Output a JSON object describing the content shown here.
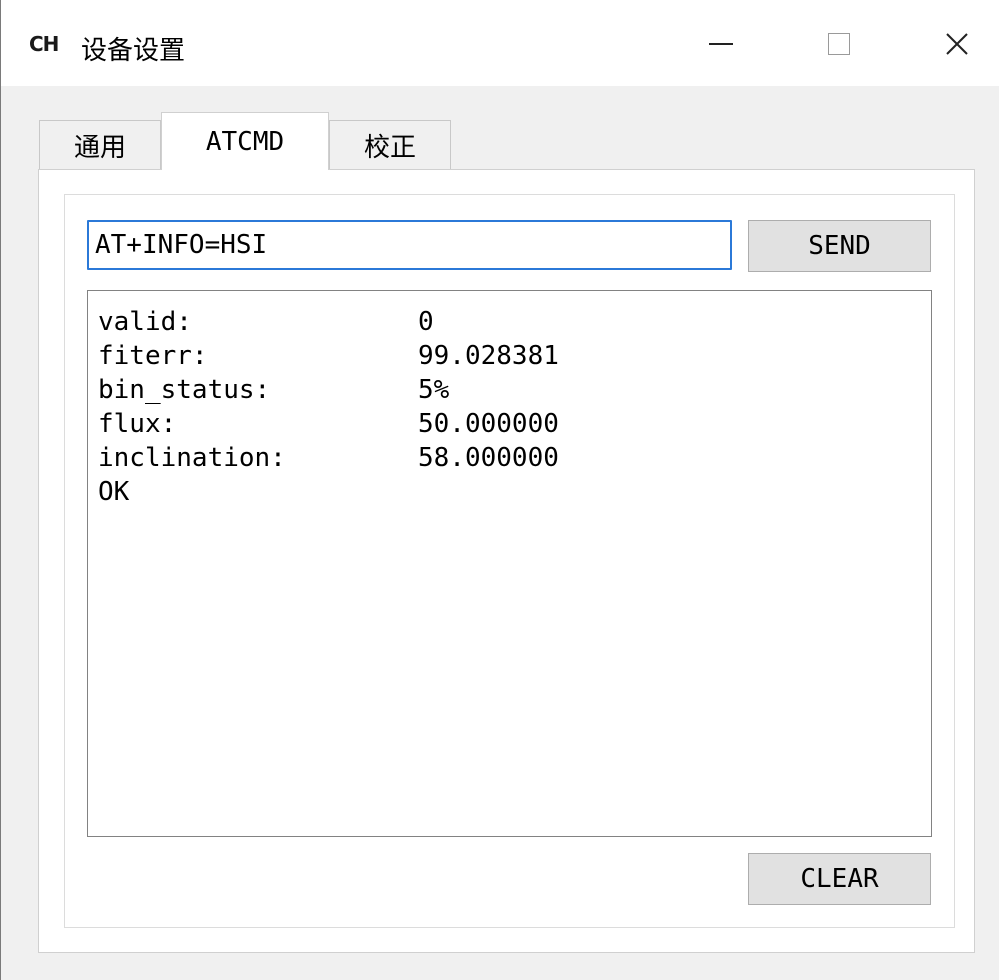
{
  "window": {
    "app_icon_text": "CH",
    "title": "设备设置",
    "controls": {
      "minimize": "minimize-icon",
      "maximize": "maximize-icon",
      "close": "close-icon",
      "close_glyph": "✕"
    }
  },
  "tabs": [
    {
      "label": "通用",
      "active": false
    },
    {
      "label": "ATCMD",
      "active": true
    },
    {
      "label": "校正",
      "active": false
    }
  ],
  "atcmd": {
    "command_value": "AT+INFO=HSI",
    "send_label": "SEND",
    "clear_label": "CLEAR",
    "output": [
      {
        "key": "valid:",
        "value": "0"
      },
      {
        "key": "fiterr:",
        "value": "99.028381"
      },
      {
        "key": "bin_status:",
        "value": "5%"
      },
      {
        "key": "flux:",
        "value": "50.000000"
      },
      {
        "key": "inclination:",
        "value": "58.000000"
      },
      {
        "key": "OK",
        "value": ""
      }
    ]
  },
  "colors": {
    "input_focus_border": "#2b79d8",
    "button_bg": "#e1e1e1",
    "window_bg": "#f0f0f0"
  }
}
